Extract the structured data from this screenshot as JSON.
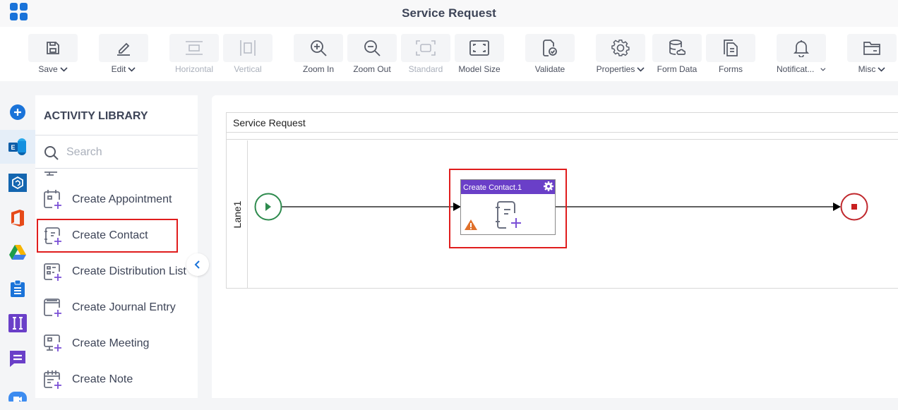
{
  "app": {
    "title": "Service Request"
  },
  "toolbar": {
    "items": [
      {
        "id": "save",
        "label": "Save",
        "icon": "save-icon",
        "dropdown": true,
        "disabled": false
      },
      {
        "id": "edit",
        "label": "Edit",
        "icon": "pencil-icon",
        "dropdown": true,
        "disabled": false
      },
      {
        "id": "horizontal",
        "label": "Horizontal",
        "icon": "horizontal-layout-icon",
        "dropdown": false,
        "disabled": true
      },
      {
        "id": "vertical",
        "label": "Vertical",
        "icon": "vertical-layout-icon",
        "dropdown": false,
        "disabled": true
      },
      {
        "id": "zoom-in",
        "label": "Zoom In",
        "icon": "zoom-in-icon",
        "dropdown": false,
        "disabled": false
      },
      {
        "id": "zoom-out",
        "label": "Zoom Out",
        "icon": "zoom-out-icon",
        "dropdown": false,
        "disabled": false
      },
      {
        "id": "standard",
        "label": "Standard",
        "icon": "standard-size-icon",
        "dropdown": false,
        "disabled": true
      },
      {
        "id": "model-size",
        "label": "Model Size",
        "icon": "fit-screen-icon",
        "dropdown": false,
        "disabled": false
      },
      {
        "id": "validate",
        "label": "Validate",
        "icon": "validate-icon",
        "dropdown": false,
        "disabled": false
      },
      {
        "id": "properties",
        "label": "Properties",
        "icon": "gear-icon",
        "dropdown": true,
        "disabled": false
      },
      {
        "id": "form-data",
        "label": "Form Data",
        "icon": "database-icon",
        "dropdown": false,
        "disabled": false
      },
      {
        "id": "forms",
        "label": "Forms",
        "icon": "forms-icon",
        "dropdown": false,
        "disabled": false
      },
      {
        "id": "notifications",
        "label": "Notificat...",
        "icon": "bell-icon",
        "dropdown": true,
        "disabled": false
      },
      {
        "id": "misc",
        "label": "Misc",
        "icon": "folder-icon",
        "dropdown": true,
        "disabled": false
      }
    ]
  },
  "left_rail": {
    "items": [
      {
        "name": "add",
        "icon": "plus-circle-icon"
      },
      {
        "name": "exchange",
        "icon": "exchange-icon",
        "active": true
      },
      {
        "name": "hexagon-app",
        "icon": "hexagon-icon"
      },
      {
        "name": "office",
        "icon": "office-icon"
      },
      {
        "name": "google-drive",
        "icon": "google-drive-icon"
      },
      {
        "name": "clipboard",
        "icon": "clipboard-icon"
      },
      {
        "name": "text-tool",
        "icon": "text-cursor-icon"
      },
      {
        "name": "chat",
        "icon": "chat-icon"
      },
      {
        "name": "video",
        "icon": "video-icon"
      }
    ]
  },
  "library": {
    "title": "ACTIVITY LIBRARY",
    "search_placeholder": "Search",
    "items": [
      {
        "label": "Create Appointment",
        "icon": "calendar-plus-icon"
      },
      {
        "label": "Create Contact",
        "icon": "contact-plus-icon",
        "selected": true
      },
      {
        "label": "Create Distribution List",
        "icon": "list-plus-icon"
      },
      {
        "label": "Create Journal Entry",
        "icon": "journal-plus-icon"
      },
      {
        "label": "Create Meeting",
        "icon": "meeting-plus-icon"
      },
      {
        "label": "Create Note",
        "icon": "note-plus-icon"
      }
    ]
  },
  "canvas": {
    "pool_title": "Service Request",
    "lane_label": "Lane1",
    "activity": {
      "title": "Create Contact.1",
      "warning": true,
      "header_color": "#6a3fc8"
    },
    "colors": {
      "start": "#2e8b4e",
      "end": "#c0282d",
      "highlight": "#e01d1d",
      "plus": "#7a4fd6"
    }
  }
}
